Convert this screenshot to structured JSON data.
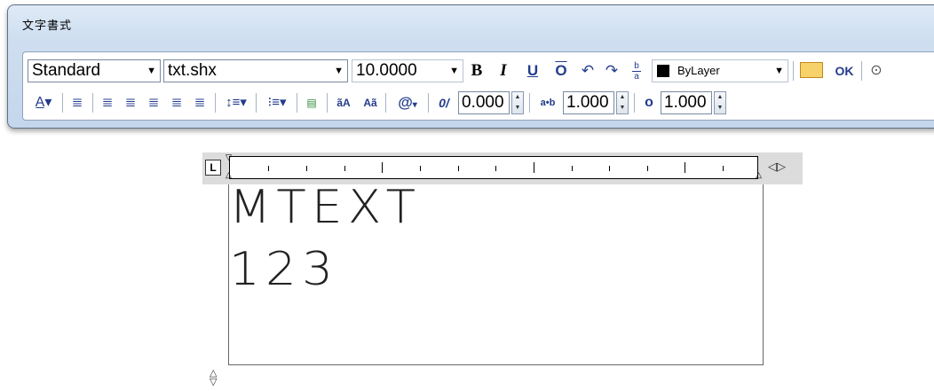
{
  "window": {
    "title": "文字書式"
  },
  "toolbar": {
    "style_value": "Standard",
    "font_value": "txt.shx",
    "height_value": "10.0000",
    "bold_label": "B",
    "italic_label": "I",
    "underline_label": "U",
    "overline_label": "O",
    "undo_icon": "undo-icon",
    "redo_icon": "redo-icon",
    "stack_label": "b/a",
    "color_value": "ByLayer",
    "ok_label": "OK",
    "options_icon": "options-chevron-icon"
  },
  "format_bar": {
    "oblique_label": "0/",
    "oblique_value": "0.000",
    "tracking_label": "a•b",
    "tracking_value": "1.000",
    "width_label": "o",
    "width_value": "1.000",
    "uppercase_label": "ãA",
    "lowercase_label": "Aã",
    "symbol_label": "@"
  },
  "editor": {
    "lines": [
      "MTEXT",
      "123"
    ]
  }
}
